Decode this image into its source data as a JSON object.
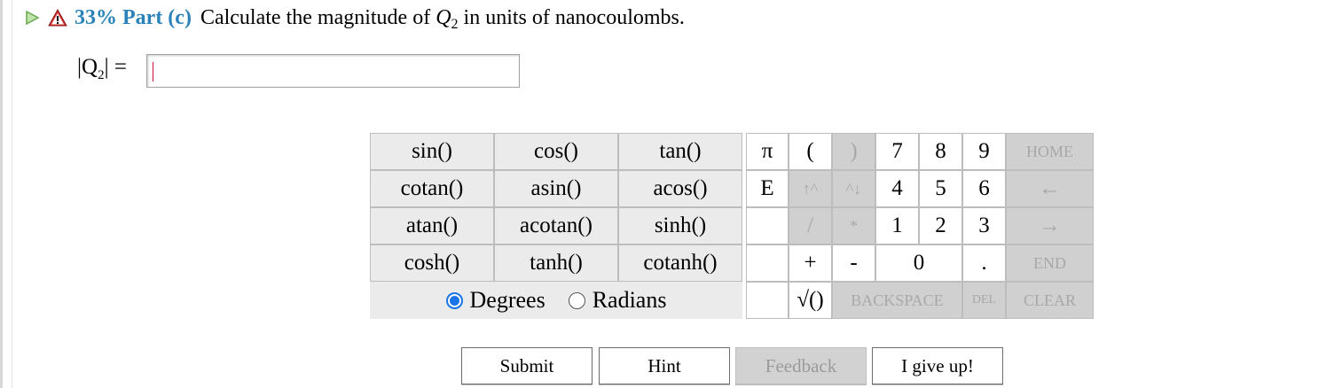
{
  "header": {
    "percent": "33%",
    "part": "Part (c)",
    "question_pre": "Calculate the magnitude of ",
    "question_var": "Q",
    "question_sub": "2",
    "question_post": " in units of nanocoulombs."
  },
  "answer": {
    "label_var": "Q",
    "label_sub": "2",
    "label_eq": "=",
    "value": ""
  },
  "keypad": {
    "functions": [
      [
        "sin()",
        "cos()",
        "tan()"
      ],
      [
        "cotan()",
        "asin()",
        "acos()"
      ],
      [
        "atan()",
        "acotan()",
        "sinh()"
      ],
      [
        "cosh()",
        "tanh()",
        "cotanh()"
      ]
    ],
    "pi": "π",
    "e": "E",
    "open_paren": "(",
    "close_paren": ")",
    "up_arrow": "↑^",
    "down_arrow": "^↓",
    "divide": "/",
    "multiply": "*",
    "plus": "+",
    "minus": "-",
    "sqrt": "√()",
    "digits": [
      "7",
      "8",
      "9",
      "4",
      "5",
      "6",
      "1",
      "2",
      "3"
    ],
    "zero": "0",
    "dot": ".",
    "home": "HOME",
    "left": "←",
    "right": "→",
    "end": "END",
    "backspace": "BACKSPACE",
    "del": "DEL",
    "clear": "CLEAR"
  },
  "angle_mode": {
    "degrees": "Degrees",
    "radians": "Radians",
    "selected": "Degrees"
  },
  "buttons": {
    "submit": "Submit",
    "hint": "Hint",
    "feedback": "Feedback",
    "give_up": "I give up!"
  },
  "colors": {
    "accent": "#2a82b9",
    "radio": "#1a73e8",
    "warning": "#d32f2f"
  }
}
